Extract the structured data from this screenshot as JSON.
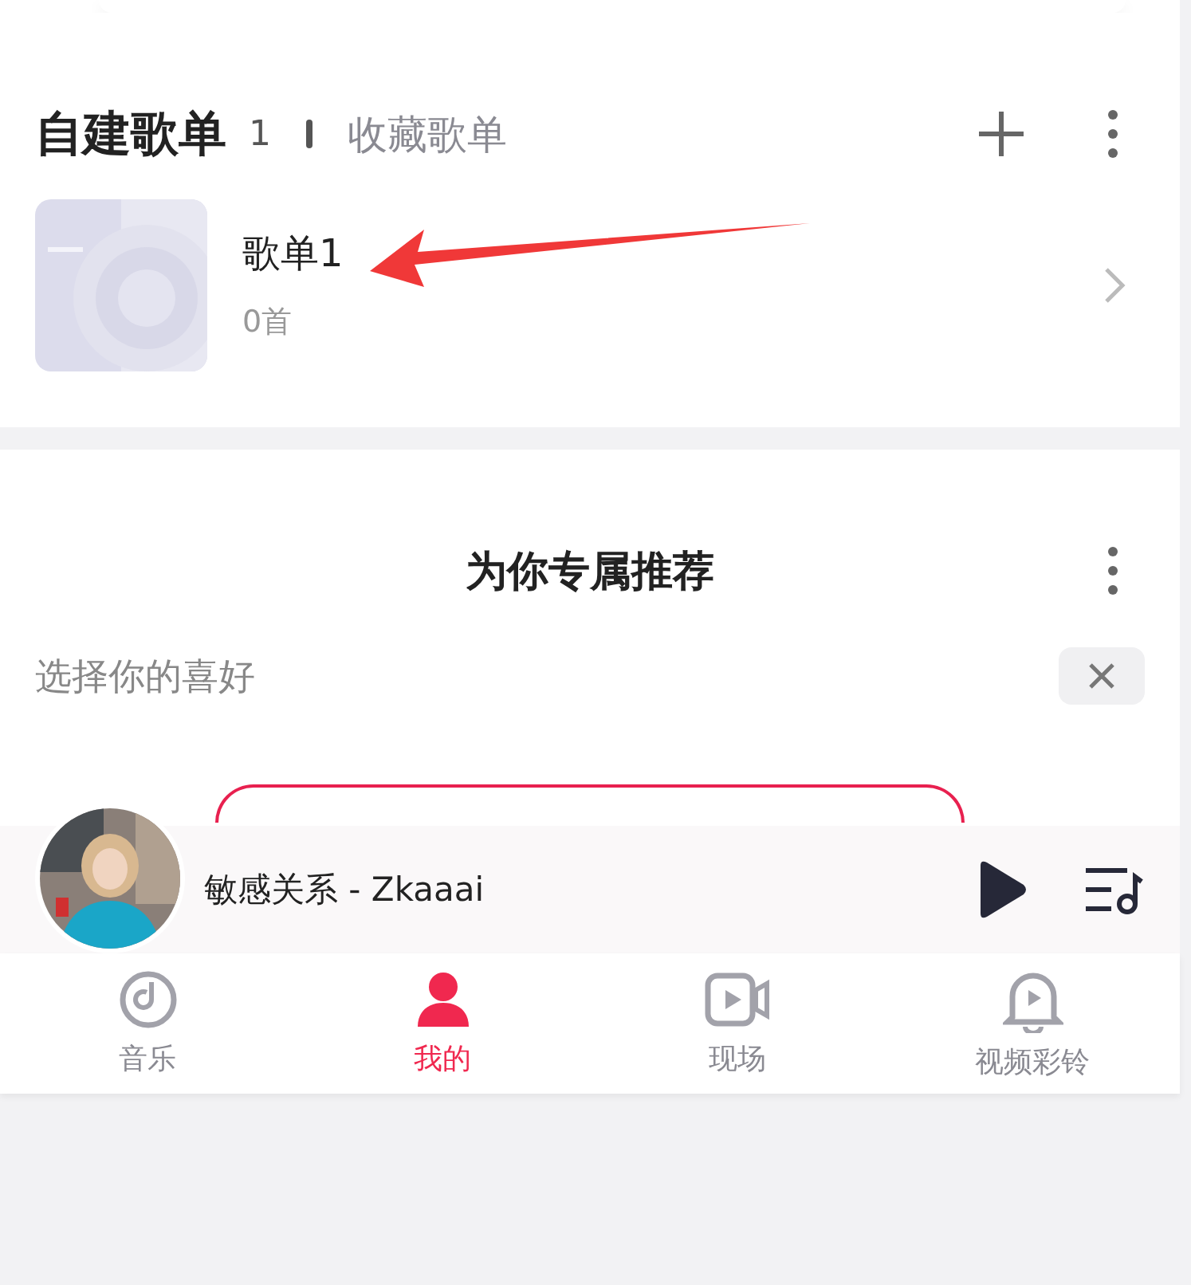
{
  "playlist_section": {
    "tabs": [
      {
        "label": "自建歌单",
        "count": "1",
        "selected": true
      },
      {
        "label": "收藏歌单",
        "selected": false
      }
    ],
    "playlists": [
      {
        "title": "歌单1",
        "subtitle": "0首"
      }
    ]
  },
  "recommend_section": {
    "title": "为你专属推荐",
    "prompt": "选择你的喜好"
  },
  "player": {
    "song": "敏感关系 - Zkaaai",
    "playing": false
  },
  "nav": [
    {
      "label": "音乐",
      "kind": "music",
      "selected": false
    },
    {
      "label": "我的",
      "kind": "me",
      "selected": true
    },
    {
      "label": "现场",
      "kind": "live",
      "selected": false
    },
    {
      "label": "视频彩铃",
      "kind": "bell",
      "selected": false
    }
  ]
}
